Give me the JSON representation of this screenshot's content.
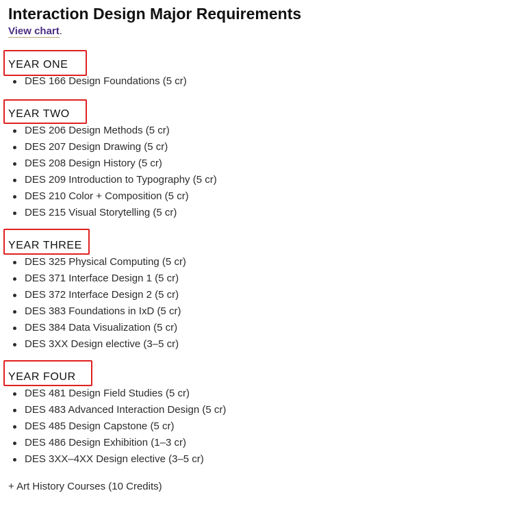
{
  "page": {
    "title": "Interaction Design Major Requirements",
    "view_chart_link": "View chart",
    "view_chart_suffix": ".",
    "art_history": "+ Art History Courses (10 Credits)"
  },
  "years": [
    {
      "heading": "YEAR ONE",
      "courses": [
        "DES 166 Design Foundations (5 cr)"
      ]
    },
    {
      "heading": "YEAR TWO",
      "courses": [
        "DES 206 Design Methods (5 cr)",
        "DES 207 Design Drawing (5 cr)",
        "DES 208 Design History (5 cr)",
        "DES 209 Introduction to Typography (5 cr)",
        "DES 210 Color + Composition (5 cr)",
        "DES 215 Visual Storytelling (5 cr)"
      ]
    },
    {
      "heading": "YEAR THREE",
      "courses": [
        "DES 325 Physical Computing (5 cr)",
        "DES 371 Interface Design 1 (5 cr)",
        "DES 372 Interface Design 2 (5 cr)",
        "DES 383 Foundations in IxD (5 cr)",
        "DES 384 Data Visualization (5 cr)",
        "DES 3XX Design elective (3–5 cr)"
      ]
    },
    {
      "heading": "YEAR FOUR",
      "courses": [
        "DES 481 Design Field Studies (5 cr)",
        "DES 483 Advanced Interaction Design (5 cr)",
        "DES 485 Design Capstone (5 cr)",
        "DES 486 Design Exhibition (1–3 cr)",
        "DES 3XX–4XX Design elective (3–5 cr)"
      ]
    }
  ],
  "colors": {
    "link": "#4b2e83",
    "highlight": "#e02020",
    "text": "#2b2b2b"
  }
}
